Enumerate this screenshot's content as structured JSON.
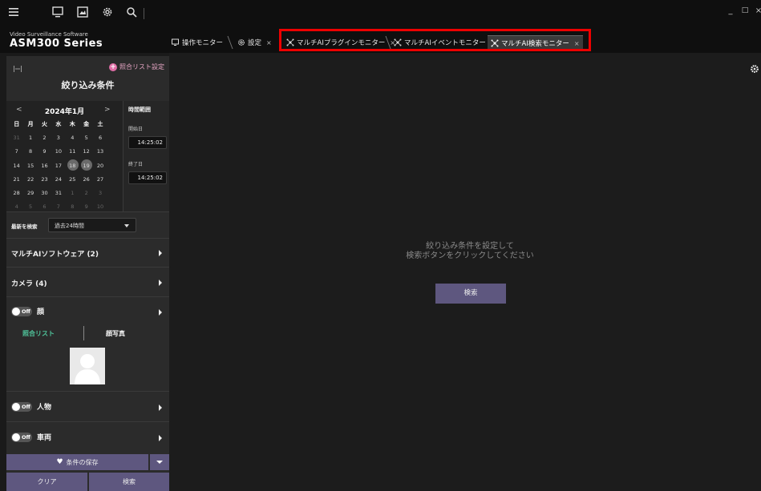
{
  "brand": {
    "subtitle": "Video Surveillance Software",
    "title": "ASM300 Series"
  },
  "window": {
    "minimize": "_",
    "maximize": "□",
    "close": "×"
  },
  "tabs": [
    {
      "label": "操作モニター",
      "close": ""
    },
    {
      "label": "設定",
      "close": "×"
    },
    {
      "label": "マルチAIプラグインモニター",
      "close": "×"
    },
    {
      "label": "マルチAIイベントモニター",
      "close": "×"
    },
    {
      "label": "マルチAI検索モニター",
      "close": "×"
    }
  ],
  "left": {
    "watchlist_settings": "照合リスト設定",
    "filter_title": "絞り込み条件",
    "calendar": {
      "prev": "<",
      "next": ">",
      "month": "2024年1月",
      "weekdays": [
        "日",
        "月",
        "火",
        "水",
        "木",
        "金",
        "土"
      ],
      "weeks": [
        [
          "31",
          "1",
          "2",
          "3",
          "4",
          "5",
          "6"
        ],
        [
          "7",
          "8",
          "9",
          "10",
          "11",
          "12",
          "13"
        ],
        [
          "14",
          "15",
          "16",
          "17",
          "18",
          "19",
          "20"
        ],
        [
          "21",
          "22",
          "23",
          "24",
          "25",
          "26",
          "27"
        ],
        [
          "28",
          "29",
          "30",
          "31",
          "1",
          "2",
          "3"
        ],
        [
          "4",
          "5",
          "6",
          "7",
          "8",
          "9",
          "10"
        ]
      ]
    },
    "time_range": {
      "title": "時間範囲",
      "start_label": "開始日",
      "start_time": "14:25:02",
      "end_label": "終了日",
      "end_time": "14:25:02"
    },
    "recent": {
      "label": "最新を検索",
      "value": "過去24時間"
    },
    "sections": {
      "software": "マルチAIソフトウェア (2)",
      "camera": "カメラ (4)",
      "face": "顔",
      "person": "人物",
      "vehicle": "車両"
    },
    "toggle_off": "Off",
    "face_tabs": {
      "watchlist": "照合リスト",
      "face_photo": "顔写真"
    },
    "save": "条件の保存",
    "clear": "クリア",
    "search": "検索"
  },
  "main": {
    "message_line1": "絞り込み条件を設定して",
    "message_line2": "検索ボタンをクリックしてください",
    "search": "検索"
  }
}
